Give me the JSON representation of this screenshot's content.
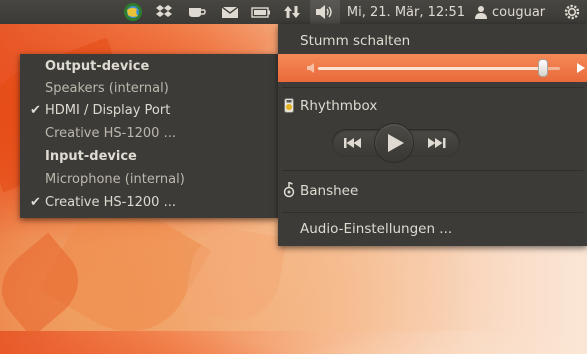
{
  "panel": {
    "datetime": "Mi, 21. Mär, 12:51",
    "username": "couguar",
    "icons": [
      "ubuntu-globe-icon",
      "dropbox-icon",
      "cup-icon",
      "mail-icon",
      "battery-icon",
      "network-arrows-icon",
      "speaker-icon",
      "user-icon",
      "power-gear-icon"
    ]
  },
  "device_menu": {
    "output_heading": "Output-device",
    "input_heading": "Input-device",
    "check_mark": "✔",
    "output_items": [
      {
        "label": "Speakers (internal)",
        "checked": false
      },
      {
        "label": "HDMI / Display Port",
        "checked": true
      },
      {
        "label": "Creative HS-1200 ...",
        "checked": false
      }
    ],
    "input_items": [
      {
        "label": "Microphone (internal)",
        "checked": false
      },
      {
        "label": "Creative HS-1200 ...",
        "checked": true
      }
    ]
  },
  "sound_menu": {
    "mute_label": "Stumm schalten",
    "volume_fraction": 0.93,
    "highlight_color": "#f07746",
    "players": [
      {
        "name": "Rhythmbox",
        "icon": "rhythmbox-icon"
      },
      {
        "name": "Banshee",
        "icon": "banshee-icon"
      }
    ],
    "settings_label": "Audio-Einstellungen ..."
  }
}
